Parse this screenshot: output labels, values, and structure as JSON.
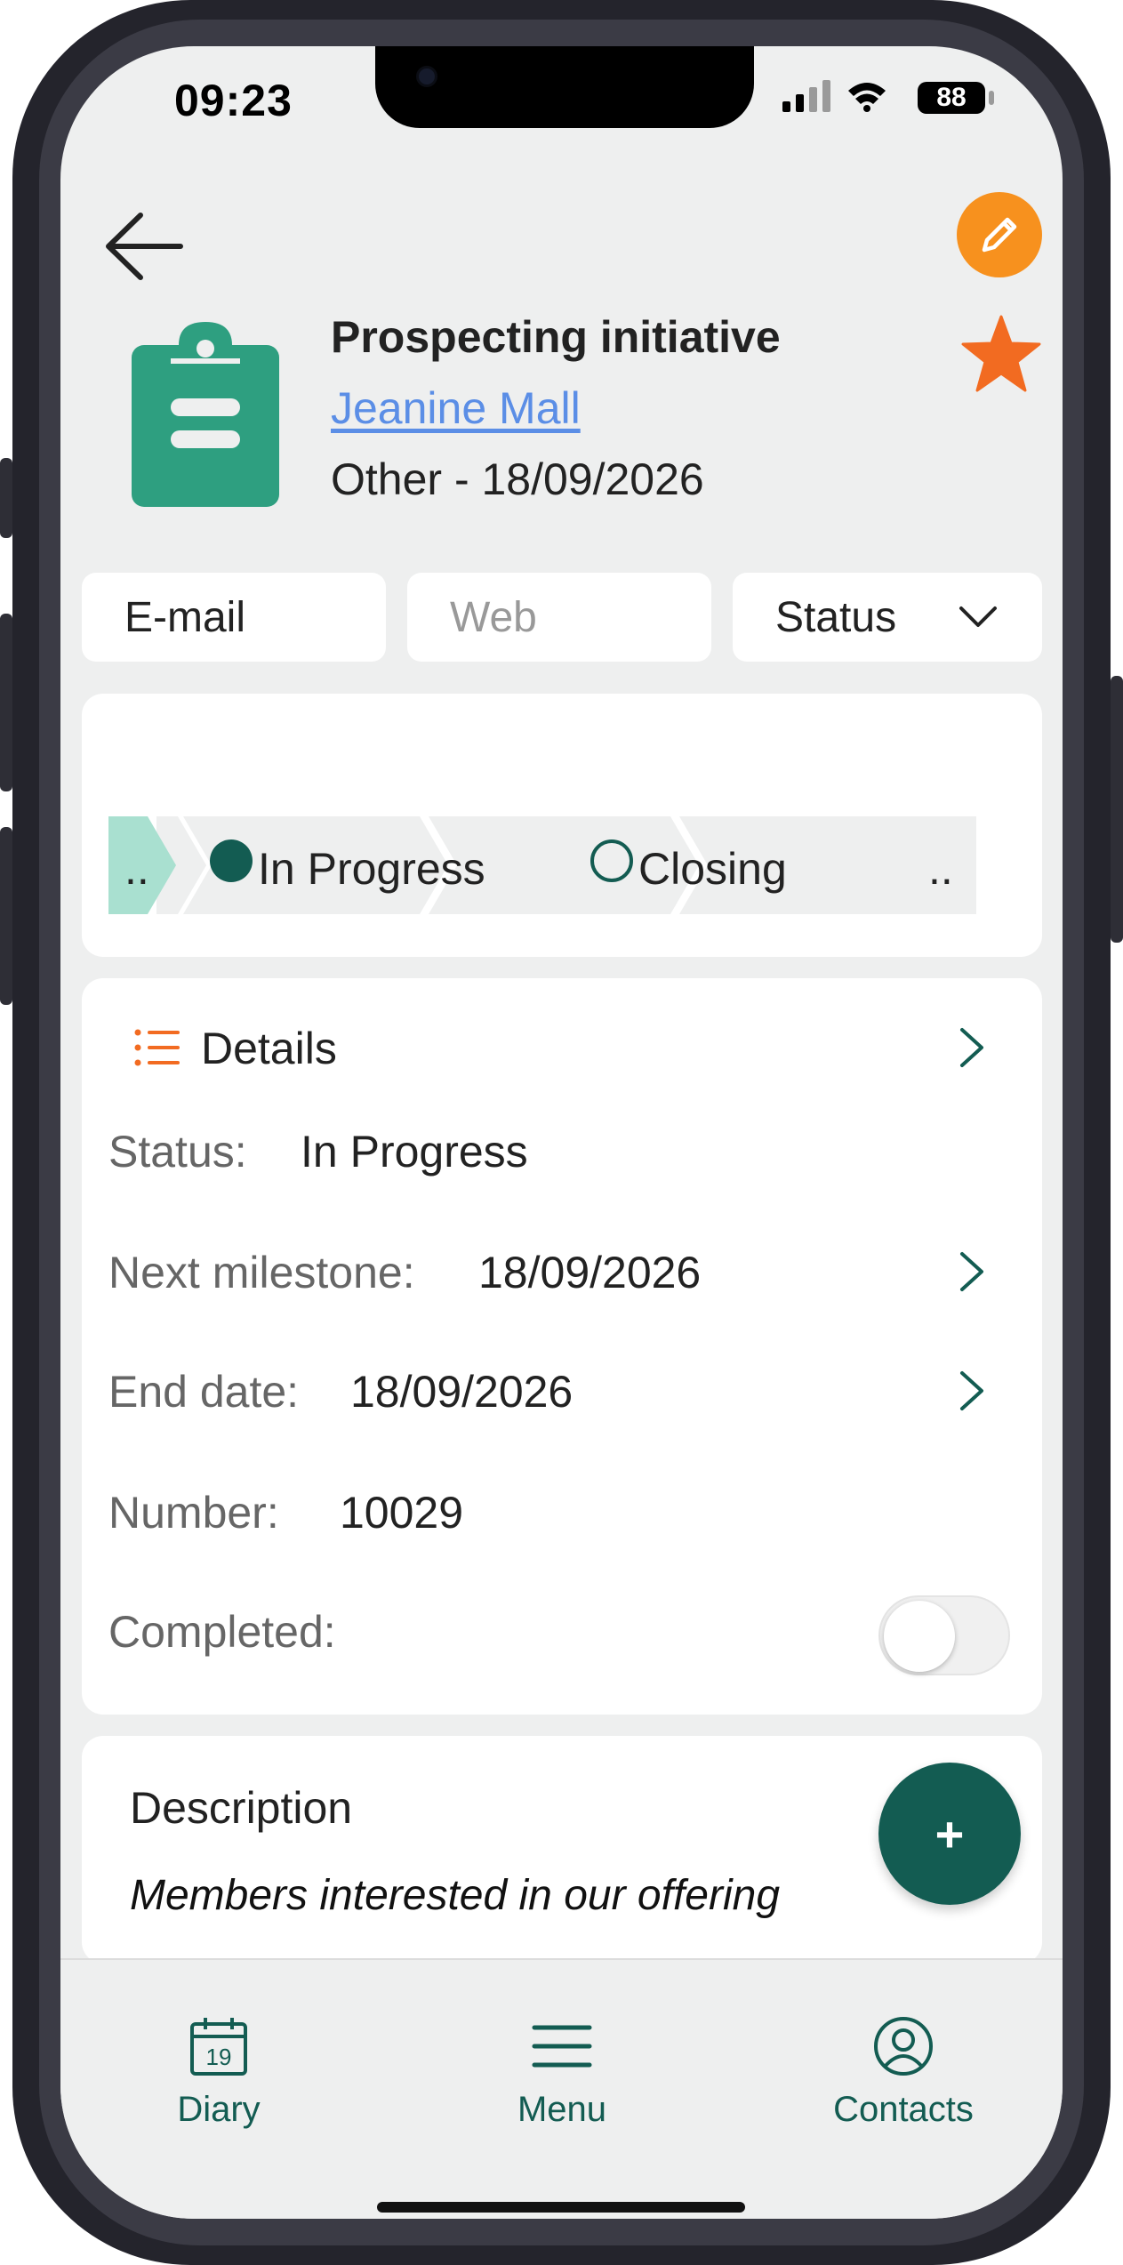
{
  "status_bar": {
    "time": "09:23",
    "battery": "88"
  },
  "header": {
    "back_icon": "arrow-left-icon",
    "edit_icon": "pencil-icon",
    "favorite_icon": "star-icon",
    "accent_orange": "#f7911e",
    "star_color": "#f26b21"
  },
  "activity": {
    "icon": "clipboard-icon",
    "icon_color": "#2e9f80",
    "title": "Prospecting initiative",
    "contact": "Jeanine Mall",
    "subtitle": "Other - 18/09/2026"
  },
  "actions": {
    "email": "E-mail",
    "web": "Web",
    "status": "Status"
  },
  "pipeline": {
    "steps": [
      {
        "label": "..",
        "state": "done"
      },
      {
        "label": "In Progress",
        "state": "current"
      },
      {
        "label": "Closing",
        "state": "upcoming"
      },
      {
        "label": "..",
        "state": "upcoming"
      }
    ]
  },
  "details": {
    "section_title": "Details",
    "status_label": "Status:",
    "status_value": "In Progress",
    "milestone_label": "Next milestone:",
    "milestone_value": "18/09/2026",
    "end_label": "End date:",
    "end_value": "18/09/2026",
    "number_label": "Number:",
    "number_value": "10029",
    "completed_label": "Completed:",
    "completed_value": false
  },
  "description": {
    "title": "Description",
    "text": "Members interested in our offering"
  },
  "fab": {
    "label": "+"
  },
  "tabbar": {
    "items": [
      {
        "label": "Diary",
        "icon": "calendar-icon",
        "day": "19"
      },
      {
        "label": "Menu",
        "icon": "hamburger-menu-icon"
      },
      {
        "label": "Contacts",
        "icon": "user-circle-icon"
      }
    ],
    "color": "#135c52"
  }
}
